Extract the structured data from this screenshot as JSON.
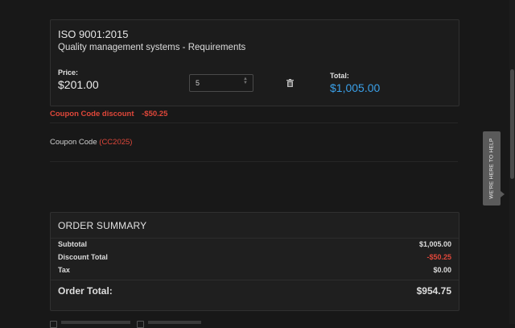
{
  "product": {
    "code": "ISO 9001:2015",
    "name": "Quality management systems - Requirements",
    "price_label": "Price:",
    "price": "$201.00",
    "quantity": "5",
    "total_label": "Total:",
    "total": "$1,005.00"
  },
  "coupon": {
    "discount_label": "Coupon Code discount",
    "discount_amount": "-$50.25",
    "code_label": "Coupon Code",
    "code": "(CC2025)"
  },
  "summary": {
    "title": "ORDER SUMMARY",
    "rows": [
      {
        "label": "Subtotal",
        "value": "$1,005.00"
      },
      {
        "label": "Discount Total",
        "value": "-$50.25"
      },
      {
        "label": "Tax",
        "value": "$0.00"
      }
    ],
    "total_label": "Order Total:",
    "total_value": "$954.75"
  },
  "help_tab": "WE'RE HERE TO HELP",
  "colors": {
    "accent_blue": "#3aa0e8",
    "discount_red": "#e0473a",
    "background": "#181818"
  }
}
